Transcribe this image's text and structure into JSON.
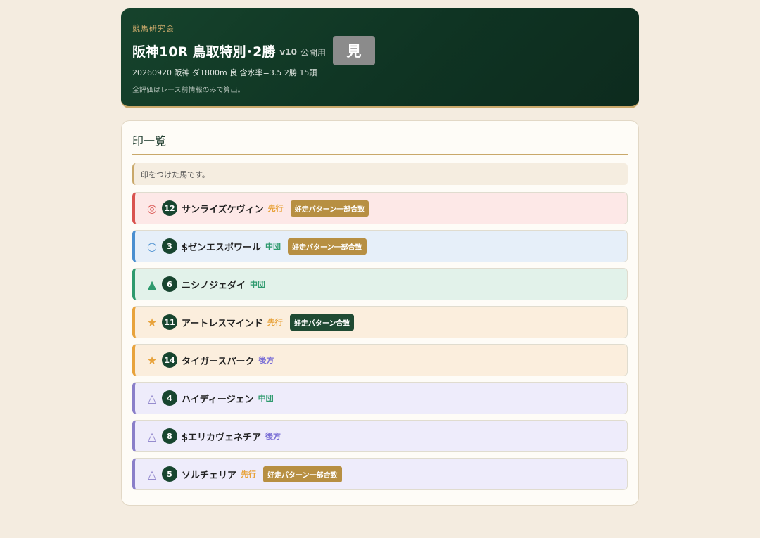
{
  "header": {
    "org": "競馬研究会",
    "title": "阪神10R 鳥取特別･2勝",
    "version": "v10",
    "public_label": "公開用",
    "view_badge": "見",
    "race_info": "20260920 阪神 ダ1800m 良 含水率=3.5 2勝 15頭",
    "note": "全評価はレース前情報のみで算出。"
  },
  "panel": {
    "title": "印一覧",
    "info": "印をつけた馬です。"
  },
  "colors": {
    "honmei": "#d9534f",
    "taikou": "#4a8fd0",
    "tanana": "#2e9a6e",
    "hoshi": "#e8a33c",
    "sankaku": "#8a7fc9",
    "senkou": "#e8a33c",
    "chuudan": "#2e9a6e",
    "kouhou": "#7b6fd6",
    "pattern_partial": "#b78f42",
    "pattern_full": "#1f4a33"
  },
  "horses": [
    {
      "mark": "◎",
      "number": "12",
      "name": "サンライズケヴィン",
      "style": "先行",
      "pattern": "好走パターン一部合致"
    },
    {
      "mark": "○",
      "number": "3",
      "name": "$ゼンエスポワール",
      "style": "中団",
      "pattern": "好走パターン一部合致"
    },
    {
      "mark": "▲",
      "number": "6",
      "name": "ニシノジェダイ",
      "style": "中団",
      "pattern": ""
    },
    {
      "mark": "★",
      "number": "11",
      "name": "アートレスマインド",
      "style": "先行",
      "pattern": "好走パターン合致"
    },
    {
      "mark": "★",
      "number": "14",
      "name": "タイガースパーク",
      "style": "後方",
      "pattern": ""
    },
    {
      "mark": "△",
      "number": "4",
      "name": "ハイディージェン",
      "style": "中団",
      "pattern": ""
    },
    {
      "mark": "△",
      "number": "8",
      "name": "$エリカヴェネチア",
      "style": "後方",
      "pattern": ""
    },
    {
      "mark": "△",
      "number": "5",
      "name": "ソルチェリア",
      "style": "先行",
      "pattern": "好走パターン一部合致"
    }
  ]
}
